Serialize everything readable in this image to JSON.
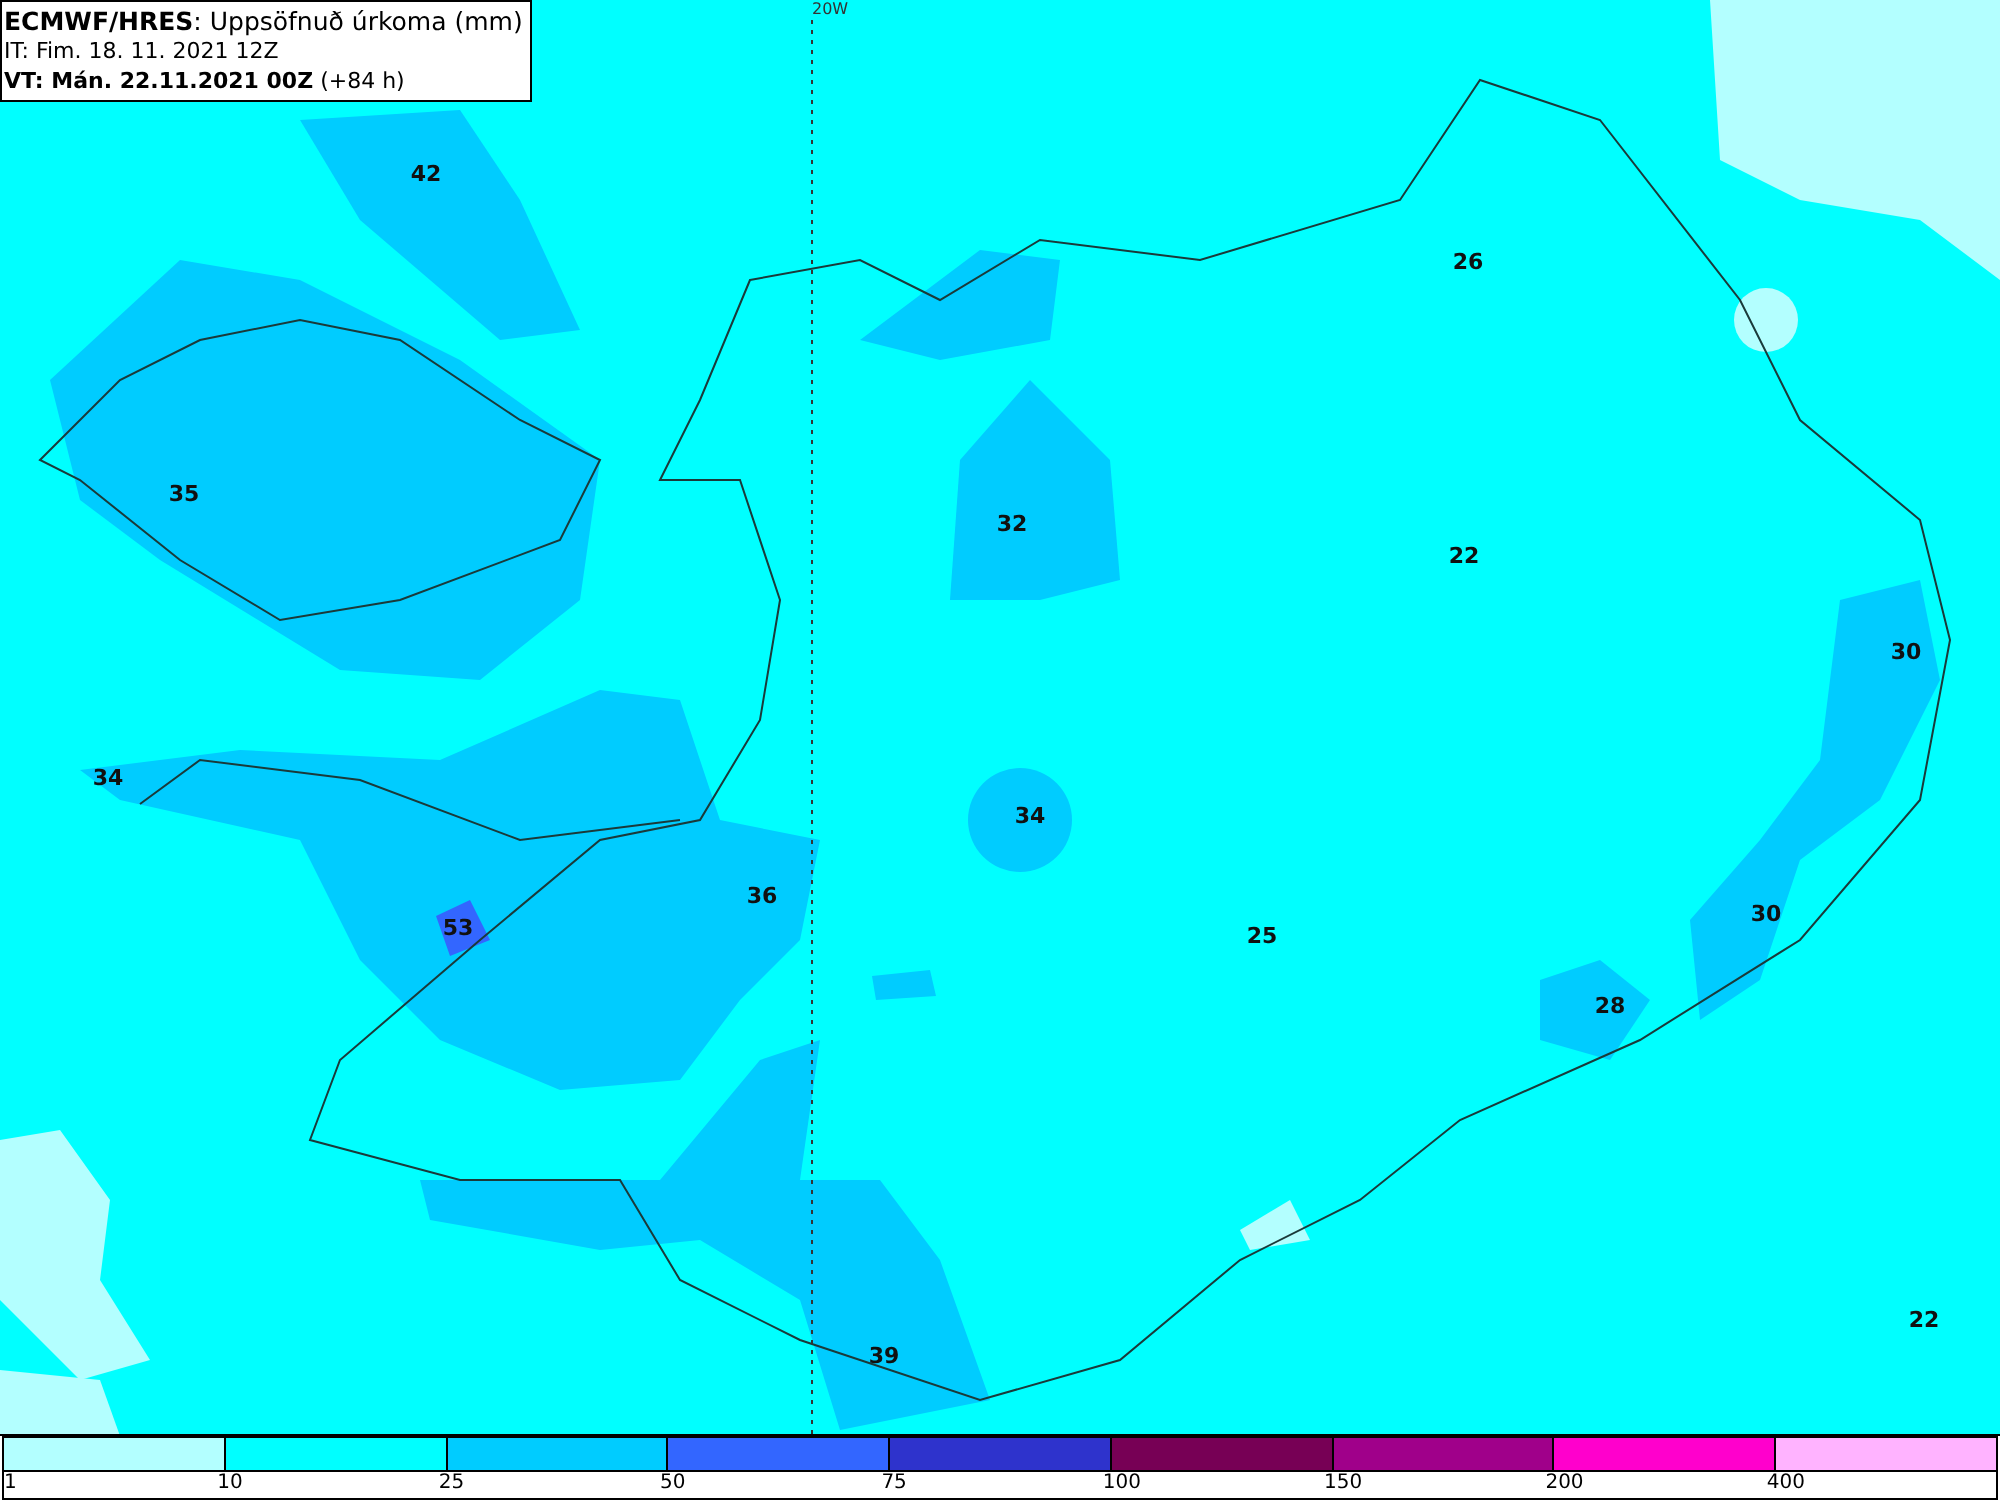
{
  "header": {
    "title_bold": "ECMWF/HRES",
    "title_rest": ": Uppsöfnuð úrkoma (mm)",
    "issue_time": "IT: Fim. 18. 11. 2021 12Z",
    "valid_bold": "VT: Mán. 22.11.2021 00Z",
    "valid_rest": "(+84 h)"
  },
  "meridian_label": "20W",
  "values": [
    {
      "text": "42"
    },
    {
      "text": "35"
    },
    {
      "text": "32"
    },
    {
      "text": "26"
    },
    {
      "text": "22"
    },
    {
      "text": "30"
    },
    {
      "text": "34"
    },
    {
      "text": "34"
    },
    {
      "text": "53"
    },
    {
      "text": "36"
    },
    {
      "text": "25"
    },
    {
      "text": "30"
    },
    {
      "text": "28"
    },
    {
      "text": "39"
    },
    {
      "text": "22"
    }
  ],
  "legend": [
    {
      "color": "#b3ffff",
      "label": "1"
    },
    {
      "color": "#00ffff",
      "label": "10"
    },
    {
      "color": "#00ccff",
      "label": "25"
    },
    {
      "color": "#3366ff",
      "label": "50"
    },
    {
      "color": "#2e33cc",
      "label": "75"
    },
    {
      "color": "#770055",
      "label": "100"
    },
    {
      "color": "#a0008a",
      "label": "150"
    },
    {
      "color": "#ff00cc",
      "label": "200"
    },
    {
      "color": "#ffb3ff",
      "label": "400"
    }
  ]
}
